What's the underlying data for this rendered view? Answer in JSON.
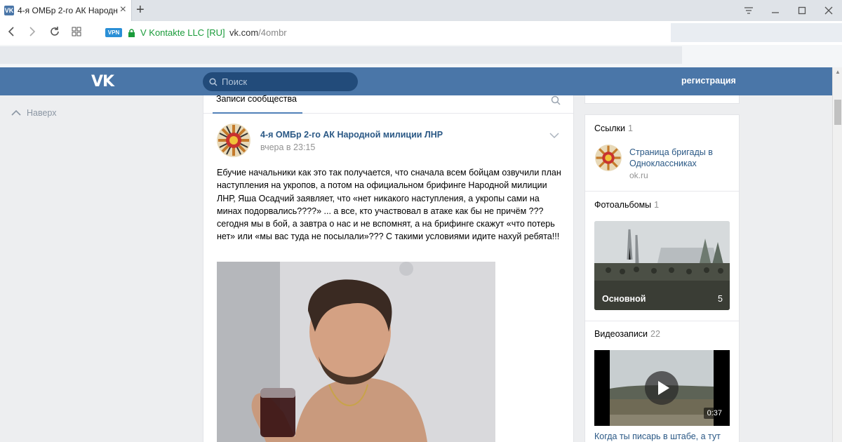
{
  "browser": {
    "tab_title": "4-я ОМБр 2-го АК Народн",
    "tab_favicon": "VK",
    "new_tab": "+",
    "vpn_badge": "VPN",
    "site_identity": "V Kontakte LLC [RU]",
    "url_host": "vk.com",
    "url_path": "/4ombr"
  },
  "header": {
    "logo": "VK",
    "search_placeholder": "Поиск",
    "register": "регистрация"
  },
  "left_nav": {
    "back_to_top": "Наверх"
  },
  "feed": {
    "tab_label": "Записи сообщества",
    "post": {
      "author": "4-я ОМБр 2-го АК Народной милиции ЛНР",
      "time": "вчера в 23:15",
      "text": "Ебучие начальники как это так получается, что сначала всем бойцам озвучили план наступления на укропов, а потом на официальном брифинге Народной милиции ЛНР, Яша Осадчий заявляет, что «нет никакого наступления, а укропы сами на минах подорвались????» ... а все, кто участвовал в атаке как бы не причём ??? сегодня мы в бой, а завтра о нас и не вспомнят, а на брифинге скажут «что потерь нет» или «мы вас туда не посылали»??? С такими условиями идите нахуй ребята!!!"
    }
  },
  "sidebar": {
    "links": {
      "heading": "Ссылки",
      "count": "1",
      "item_title": "Страница бригады в Одноклассниках",
      "item_host": "ok.ru"
    },
    "albums": {
      "heading": "Фотоальбомы",
      "count": "1",
      "album_name": "Основной",
      "album_count": "5"
    },
    "videos": {
      "heading": "Видеозаписи",
      "count": "22",
      "duration": "0:37",
      "video_title": "Когда ты писарь в штабе, а тут"
    }
  },
  "colors": {
    "vk_blue": "#4a76a8",
    "link": "#2a5885",
    "page_bg": "#edeef0"
  }
}
